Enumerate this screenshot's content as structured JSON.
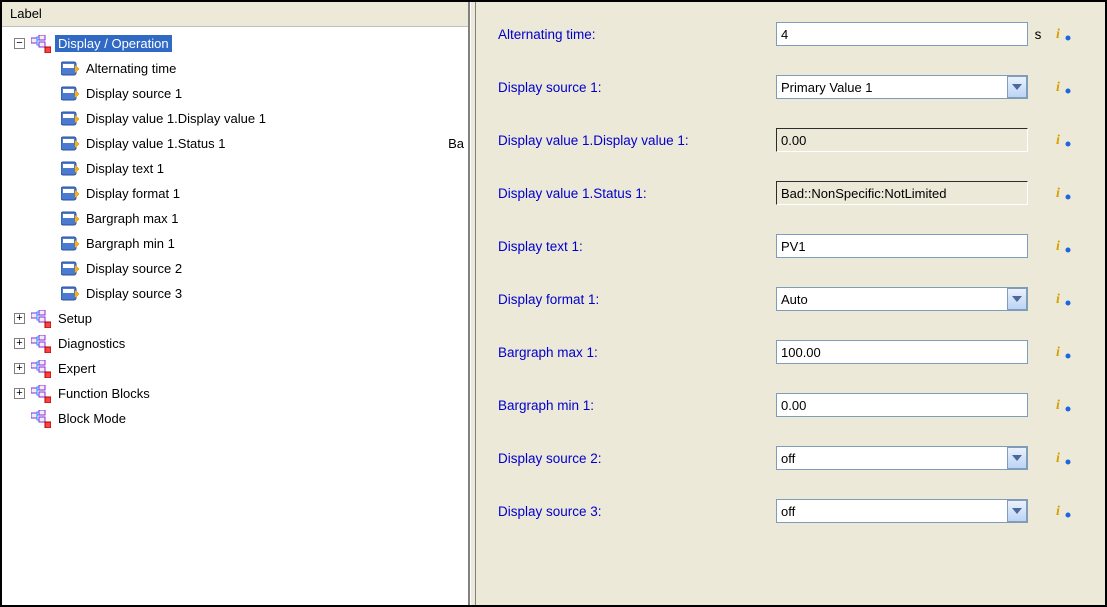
{
  "tree": {
    "header": "Label",
    "root": {
      "label": "Display / Operation",
      "children": [
        {
          "label": "Alternating time"
        },
        {
          "label": "Display source 1"
        },
        {
          "label": "Display value 1.Display value 1"
        },
        {
          "label": "Display value 1.Status 1",
          "extra": "Ba"
        },
        {
          "label": "Display text 1"
        },
        {
          "label": "Display format 1"
        },
        {
          "label": "Bargraph max 1"
        },
        {
          "label": "Bargraph min 1"
        },
        {
          "label": "Display source 2"
        },
        {
          "label": "Display source 3"
        }
      ]
    },
    "siblings": [
      {
        "label": "Setup",
        "expandable": true
      },
      {
        "label": "Diagnostics",
        "expandable": true
      },
      {
        "label": "Expert",
        "expandable": true
      },
      {
        "label": "Function Blocks",
        "expandable": true
      },
      {
        "label": "Block Mode",
        "expandable": false
      }
    ]
  },
  "form": {
    "alt_time": {
      "label": "Alternating time:",
      "value": "4",
      "unit": "s",
      "type": "text"
    },
    "src1": {
      "label": "Display source 1:",
      "value": "Primary Value 1",
      "type": "select"
    },
    "val1": {
      "label": "Display value 1.Display value 1:",
      "value": "0.00",
      "type": "readonly"
    },
    "status1": {
      "label": "Display value 1.Status 1:",
      "value": "Bad::NonSpecific:NotLimited",
      "type": "readonly"
    },
    "text1": {
      "label": "Display text 1:",
      "value": "PV1",
      "type": "text"
    },
    "format1": {
      "label": "Display format 1:",
      "value": "Auto",
      "type": "select"
    },
    "barmax1": {
      "label": "Bargraph max 1:",
      "value": "100.00",
      "type": "text"
    },
    "barmin1": {
      "label": "Bargraph min 1:",
      "value": "0.00",
      "type": "text"
    },
    "src2": {
      "label": "Display source 2:",
      "value": "off",
      "type": "select"
    },
    "src3": {
      "label": "Display source 3:",
      "value": "off",
      "type": "select"
    }
  }
}
